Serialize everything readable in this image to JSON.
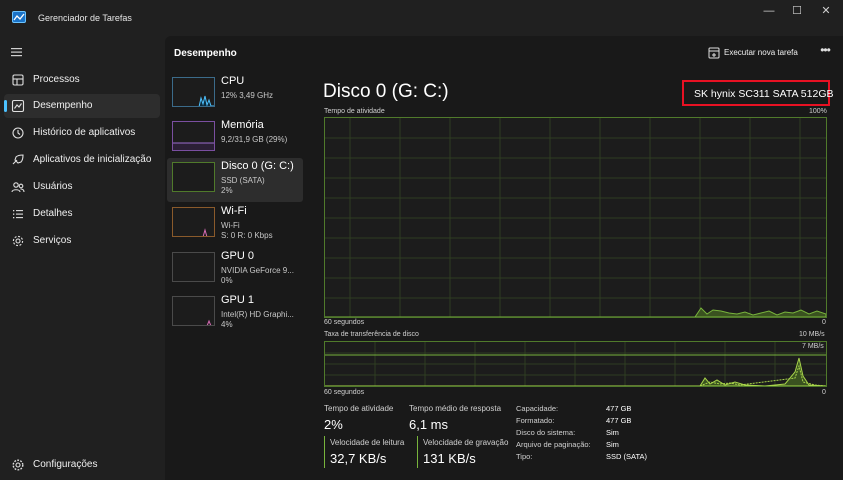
{
  "window": {
    "title": "Gerenciador de Tarefas",
    "minimize": "—",
    "maximize": "☐",
    "close": "✕"
  },
  "sidebar": {
    "items": [
      {
        "label": "Processos",
        "icon": "processes-icon"
      },
      {
        "label": "Desempenho",
        "icon": "performance-icon",
        "active": true
      },
      {
        "label": "Histórico de aplicativos",
        "icon": "app-history-icon"
      },
      {
        "label": "Aplicativos de inicialização",
        "icon": "startup-apps-icon"
      },
      {
        "label": "Usuários",
        "icon": "users-icon"
      },
      {
        "label": "Detalhes",
        "icon": "details-icon"
      },
      {
        "label": "Serviços",
        "icon": "services-icon"
      }
    ],
    "settings": "Configurações"
  },
  "header": {
    "title": "Desempenho",
    "run_task": "Executar nova tarefa",
    "more": "•••"
  },
  "resources": [
    {
      "name": "CPU",
      "sub1": "12% 3,49 GHz",
      "sub2": ""
    },
    {
      "name": "Memória",
      "sub1": "9,2/31,9 GB (29%)",
      "sub2": ""
    },
    {
      "name": "Disco 0 (G: C:)",
      "sub1": "SSD (SATA)",
      "sub2": "2%",
      "active": true
    },
    {
      "name": "Wi-Fi",
      "sub1": "Wi-Fi",
      "sub2": "S: 0 R: 0 Kbps"
    },
    {
      "name": "GPU 0",
      "sub1": "NVIDIA GeForce 9...",
      "sub2": "0%"
    },
    {
      "name": "GPU 1",
      "sub1": "Intel(R) HD Graphi...",
      "sub2": "4%"
    }
  ],
  "detail": {
    "title": "Disco 0 (G: C:)",
    "model": "SK hynix SC311 SATA 512GB",
    "graph1": {
      "label": "Tempo de atividade",
      "max": "100%",
      "time": "60 segundos",
      "min": "0"
    },
    "graph2": {
      "label": "Taxa de transferência de disco",
      "max": "10 MB/s",
      "marker": "7 MB/s",
      "time": "60 segundos",
      "min": "0"
    },
    "stats": {
      "active_time_label": "Tempo de atividade",
      "active_time_value": "2%",
      "avg_response_label": "Tempo médio de resposta",
      "avg_response_value": "6,1 ms",
      "read_speed_label": "Velocidade de leitura",
      "read_speed_value": "32,7 KB/s",
      "write_speed_label": "Velocidade de gravação",
      "write_speed_value": "131 KB/s"
    },
    "properties": [
      {
        "label": "Capacidade:",
        "value": "477 GB"
      },
      {
        "label": "Formatado:",
        "value": "477 GB"
      },
      {
        "label": "Disco do sistema:",
        "value": "Sim"
      },
      {
        "label": "Arquivo de paginação:",
        "value": "Sim"
      },
      {
        "label": "Tipo:",
        "value": "SSD (SATA)"
      }
    ]
  },
  "colors": {
    "accent": "#4cc2ff",
    "disk_green": "#78b43c",
    "highlight_red": "#e81123"
  }
}
